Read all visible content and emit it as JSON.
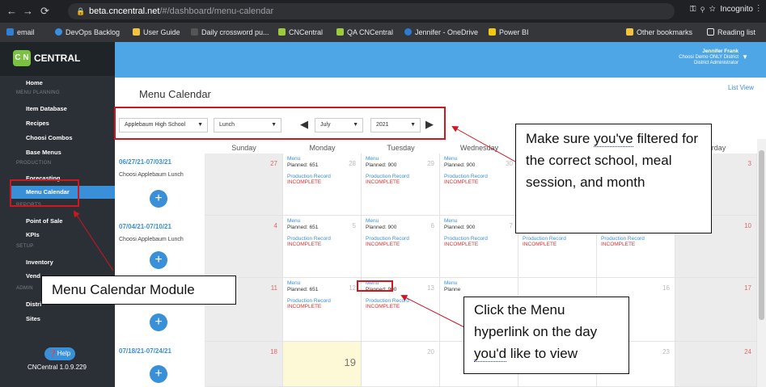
{
  "browser": {
    "url_host": "beta.cncentral.net",
    "url_path": "/#/dashboard/menu-calendar",
    "profile": "Incognito",
    "bookmarks": [
      "email",
      "DevOps Backlog",
      "User Guide",
      "Daily crossword pu...",
      "CNCentral",
      "QA CNCentral",
      "Jennifer - OneDrive",
      "Power BI"
    ],
    "other_bookmarks": "Other bookmarks",
    "reading_list": "Reading list"
  },
  "app": {
    "logo_mark": "C N",
    "logo_text": "CENTRAL",
    "sidebar": {
      "home": "Home",
      "menu_planning": "MENU PLANNING",
      "item_database": "Item Database",
      "recipes": "Recipes",
      "choosi_combos": "Choosi Combos",
      "base_menus": "Base Menus",
      "production": "PRODUCTION",
      "forecasting": "Forecasting",
      "menu_calendar": "Menu Calendar",
      "reports": "REPORTS",
      "point_of_sale": "Point of Sale",
      "kpis": "KPIs",
      "setup": "SETUP",
      "inventory": "Inventory",
      "vendors": "Vend",
      "admin": "ADMIN",
      "districts": "Distri",
      "sites": "Sites"
    },
    "help": "Help",
    "version": "CNCentral 1.0.9.229",
    "user": {
      "name": "Jennifer Frank",
      "district": "Choosi Demo ONLY District",
      "role": "District Administrator"
    }
  },
  "page": {
    "title": "Menu Calendar",
    "list_view": "List View",
    "filters": {
      "school": "Applebaum High School",
      "meal": "Lunch",
      "month": "July",
      "year": "2021"
    },
    "days": [
      "Sunday",
      "Monday",
      "Tuesday",
      "Wednesday",
      "Thursday",
      "Friday",
      "Saturday"
    ],
    "saturday_partial": "urday",
    "menu": "Menu",
    "production_record": "Production Record",
    "incomplete": "INCOMPLETE",
    "weeks": [
      {
        "range": "06/27/21-07/03/21",
        "label": "Choosi Applebaum Lunch",
        "nums": [
          "27",
          "28",
          "29",
          "30",
          "",
          "",
          "3"
        ],
        "planned": [
          "",
          "Planned: 651",
          "Planned: 900",
          "Planned: 900",
          "",
          "",
          ""
        ]
      },
      {
        "range": "07/04/21-07/10/21",
        "label": "Choosi Applebaum Lunch",
        "nums": [
          "4",
          "5",
          "6",
          "7",
          "8",
          "9",
          "10"
        ],
        "planned": [
          "",
          "Planned: 651",
          "Planned: 900",
          "Planned: 900",
          "Planned: 900",
          "Planned: 900",
          ""
        ]
      },
      {
        "range": "",
        "label": "",
        "nums": [
          "11",
          "12",
          "13",
          "",
          "",
          "16",
          "17"
        ],
        "planned": [
          "",
          "Planned: 651",
          "Planned: 900",
          "Planne",
          "",
          "",
          ""
        ]
      },
      {
        "range": "07/18/21-07/24/21",
        "label": "",
        "nums": [
          "18",
          "19",
          "20",
          "",
          "",
          "23",
          "24"
        ],
        "planned": [
          "",
          "",
          "",
          "",
          "",
          "",
          ""
        ]
      }
    ]
  },
  "annotations": {
    "filter_note_1": "Make sure ",
    "filter_note_2": "you've",
    "filter_note_3": "filtered for the correct school, meal session, and month",
    "module_note": "Menu Calendar Module",
    "click_note_1": "Click the Menu hyperlink on the day ",
    "click_note_2": "you'd",
    "click_note_3": " like to view"
  }
}
